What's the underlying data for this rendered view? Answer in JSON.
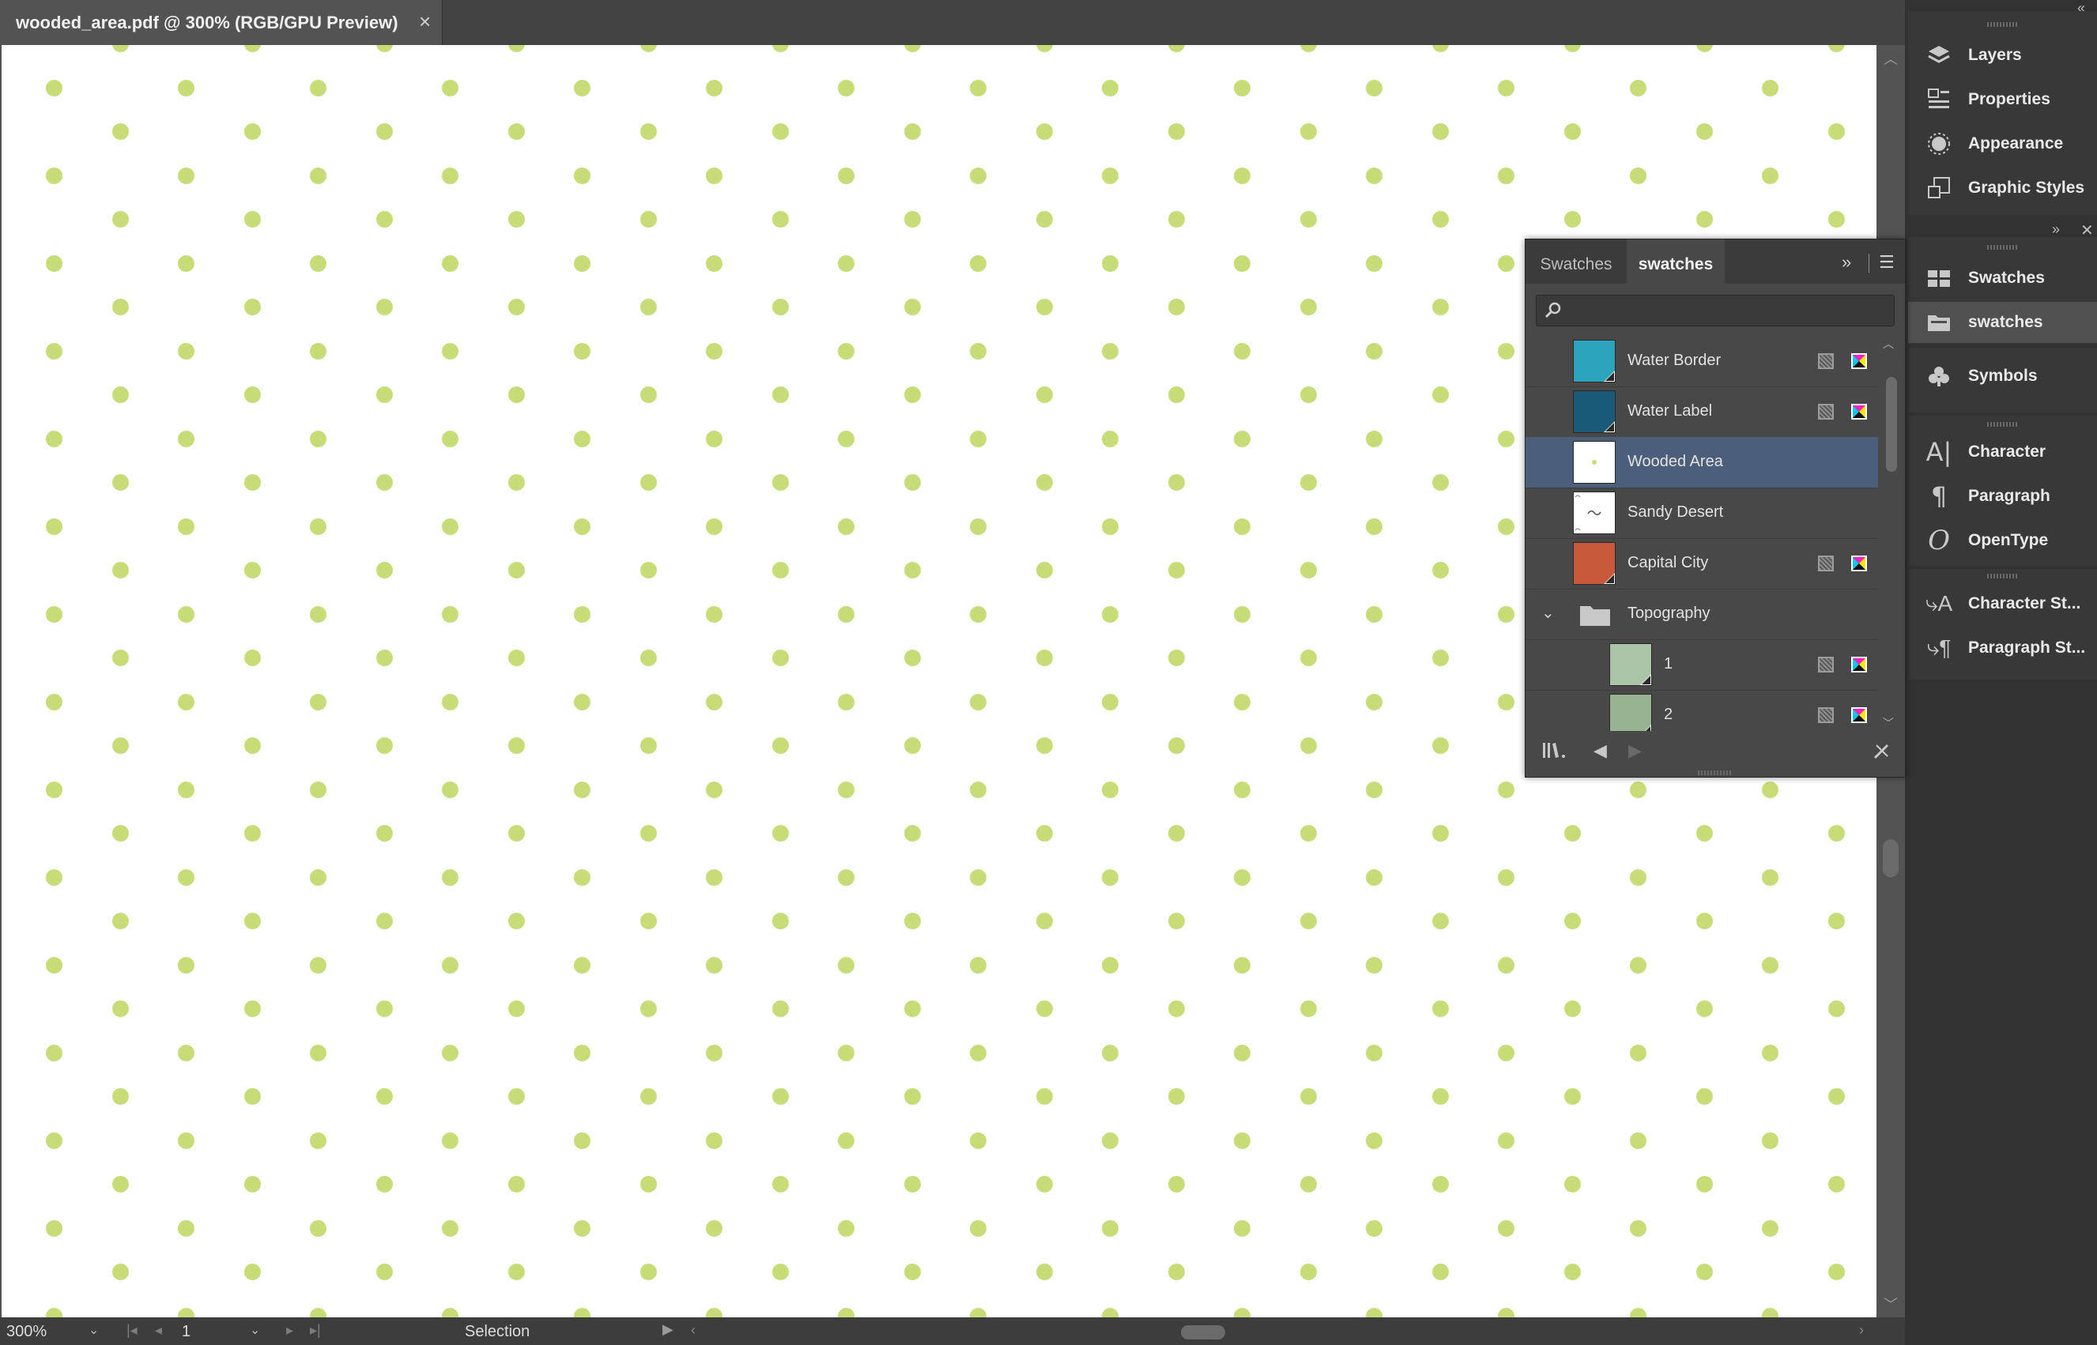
{
  "document_tab": {
    "title": "wooded_area.pdf @ 300% (RGB/GPU Preview)",
    "close": "×"
  },
  "canvas": {
    "background": "#ffffff",
    "dot_color": "#c6dc77"
  },
  "status_bar": {
    "zoom": "300%",
    "page": "1",
    "tool": "Selection"
  },
  "dock": {
    "group1": [
      {
        "label": "Layers",
        "icon": "layers-icon"
      },
      {
        "label": "Properties",
        "icon": "properties-icon"
      },
      {
        "label": "Appearance",
        "icon": "appearance-icon"
      },
      {
        "label": "Graphic Styles",
        "icon": "graphic-styles-icon"
      }
    ],
    "group2": [
      {
        "label": "Swatches",
        "icon": "swatches-icon"
      },
      {
        "label": "swatches",
        "icon": "swatch-library-icon"
      }
    ],
    "group3": [
      {
        "label": "Symbols",
        "icon": "symbols-icon"
      }
    ],
    "group4": [
      {
        "label": "Character",
        "icon": "character-icon"
      },
      {
        "label": "Paragraph",
        "icon": "paragraph-icon"
      },
      {
        "label": "OpenType",
        "icon": "opentype-icon"
      }
    ],
    "group5": [
      {
        "label": "Character St...",
        "icon": "character-styles-icon"
      },
      {
        "label": "Paragraph St...",
        "icon": "paragraph-styles-icon"
      }
    ]
  },
  "swatches_panel": {
    "tabs": [
      "Swatches",
      "swatches"
    ],
    "active_tab": "swatches",
    "search": {
      "value": "",
      "placeholder": ""
    },
    "rows": [
      {
        "name": "Water Border",
        "color": "#2ba3bd"
      },
      {
        "name": "Water Label",
        "color": "#185a78"
      },
      {
        "name": "Wooded Area",
        "pattern": "dot",
        "selected": true
      },
      {
        "name": "Sandy Desert",
        "pattern": "tilde"
      },
      {
        "name": "Capital City",
        "color": "#c8593a"
      }
    ],
    "folder": {
      "name": "Topography"
    },
    "folder_rows": [
      {
        "name": "1",
        "color": "#a9c4a6"
      },
      {
        "name": "2",
        "color": "#97b392"
      }
    ]
  }
}
